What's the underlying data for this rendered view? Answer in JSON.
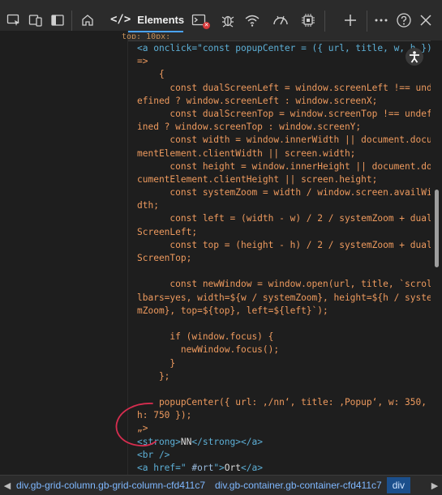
{
  "toolbar": {
    "tab_label": "Elements",
    "tab_glyph": "</>",
    "issues_badge": "",
    "icons": [
      "inspect-icon",
      "device-emulation-icon",
      "dock-icon",
      "home-icon",
      "console-icon",
      "sources-bug-icon",
      "network-wifi-icon",
      "performance-icon",
      "memory-chip-icon",
      "plus-icon",
      "more-icon",
      "help-icon",
      "close-icon"
    ]
  },
  "editor": {
    "partial_top": "top: 10px; ",
    "lines": [
      {
        "type": "tag",
        "text": "<a onclick=\"const popupCenter = ({ url, title, w, h })"
      },
      {
        "type": "code",
        "text": "=>"
      },
      {
        "type": "code",
        "text": "    {"
      },
      {
        "type": "code",
        "text": "      const dualScreenLeft = window.screenLeft !== und"
      },
      {
        "type": "code",
        "text": "efined ? window.screenLeft : window.screenX;"
      },
      {
        "type": "code",
        "text": "      const dualScreenTop = window.screenTop !== undef"
      },
      {
        "type": "code",
        "text": "ined ? window.screenTop : window.screenY;"
      },
      {
        "type": "code",
        "text": "      const width = window.innerWidth || document.docu"
      },
      {
        "type": "code",
        "text": "mentElement.clientWidth || screen.width;"
      },
      {
        "type": "code",
        "text": "      const height = window.innerHeight || document.do"
      },
      {
        "type": "code",
        "text": "cumentElement.clientHeight || screen.height;"
      },
      {
        "type": "code",
        "text": "      const systemZoom = width / window.screen.availWi"
      },
      {
        "type": "code",
        "text": "dth;"
      },
      {
        "type": "code",
        "text": "      const left = (width - w) / 2 / systemZoom + dual"
      },
      {
        "type": "code",
        "text": "ScreenLeft;"
      },
      {
        "type": "code",
        "text": "      const top = (height - h) / 2 / systemZoom + dual"
      },
      {
        "type": "code",
        "text": "ScreenTop;"
      },
      {
        "type": "code",
        "text": ""
      },
      {
        "type": "code",
        "text": "      const newWindow = window.open(url, title, `scrol"
      },
      {
        "type": "code",
        "text": "lbars=yes, width=${w / systemZoom}, height=${h / syste"
      },
      {
        "type": "code",
        "text": "mZoom}, top=${top}, left=${left}`);"
      },
      {
        "type": "code",
        "text": ""
      },
      {
        "type": "code",
        "text": "      if (window.focus) {"
      },
      {
        "type": "code",
        "text": "        newWindow.focus();"
      },
      {
        "type": "code",
        "text": "      }"
      },
      {
        "type": "code",
        "text": "    };"
      },
      {
        "type": "code",
        "text": ""
      },
      {
        "type": "code",
        "text": "    popupCenter({ url: ,/nn‘, title: ,Popup‘, w: 350,"
      },
      {
        "type": "code",
        "text": "h: 750 });"
      },
      {
        "type": "code",
        "text": "„>"
      },
      {
        "type": "mixed",
        "parts": [
          [
            "tag",
            "<strong>"
          ],
          [
            "txt",
            "NN"
          ],
          [
            "tag",
            "</strong></a>"
          ]
        ]
      },
      {
        "type": "tag",
        "text": "<br />"
      },
      {
        "type": "mixed",
        "parts": [
          [
            "tag",
            "<a href=\""
          ],
          [
            "attr",
            " #ort"
          ],
          [
            "tag",
            "\">"
          ],
          [
            "txt",
            "Ort"
          ],
          [
            "tag",
            "</a>"
          ]
        ]
      }
    ]
  },
  "breadcrumb": {
    "items": [
      "div.gb-grid-column.gb-grid-column-cfd411c7",
      "div.gb-container.gb-container-cfd411c7",
      "div"
    ]
  },
  "colors": {
    "accent": "#4aa3ff",
    "annotation": "#d62d4f"
  }
}
